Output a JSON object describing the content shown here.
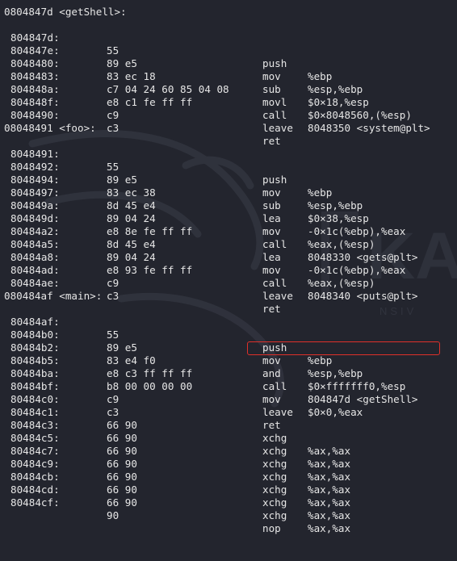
{
  "accent_colors": {
    "background": "#23252e",
    "text": "#e6e6e6",
    "highlight_border": "#e0302a"
  },
  "watermark": {
    "icon": "kali-dragon-logo",
    "text_large": "KA",
    "text_small": "NSIV"
  },
  "functions": [
    {
      "header": "0804847d <getShell>:",
      "rows": [
        {
          "addr": "804847d:",
          "bytes": "55",
          "mnem": "push",
          "ops": "%ebp"
        },
        {
          "addr": "804847e:",
          "bytes": "89 e5",
          "mnem": "mov",
          "ops": "%esp,%ebp"
        },
        {
          "addr": "8048480:",
          "bytes": "83 ec 18",
          "mnem": "sub",
          "ops": "$0×18,%esp"
        },
        {
          "addr": "8048483:",
          "bytes": "c7 04 24 60 85 04 08",
          "mnem": "movl",
          "ops": "$0×8048560,(%esp)"
        },
        {
          "addr": "804848a:",
          "bytes": "e8 c1 fe ff ff",
          "mnem": "call",
          "ops": "8048350 <system@plt>"
        },
        {
          "addr": "804848f:",
          "bytes": "c9",
          "mnem": "leave",
          "ops": ""
        },
        {
          "addr": "8048490:",
          "bytes": "c3",
          "mnem": "ret",
          "ops": ""
        }
      ]
    },
    {
      "header": "08048491 <foo>:",
      "rows": [
        {
          "addr": "8048491:",
          "bytes": "55",
          "mnem": "push",
          "ops": "%ebp"
        },
        {
          "addr": "8048492:",
          "bytes": "89 e5",
          "mnem": "mov",
          "ops": "%esp,%ebp"
        },
        {
          "addr": "8048494:",
          "bytes": "83 ec 38",
          "mnem": "sub",
          "ops": "$0×38,%esp"
        },
        {
          "addr": "8048497:",
          "bytes": "8d 45 e4",
          "mnem": "lea",
          "ops": "-0×1c(%ebp),%eax"
        },
        {
          "addr": "804849a:",
          "bytes": "89 04 24",
          "mnem": "mov",
          "ops": "%eax,(%esp)"
        },
        {
          "addr": "804849d:",
          "bytes": "e8 8e fe ff ff",
          "mnem": "call",
          "ops": "8048330 <gets@plt>"
        },
        {
          "addr": "80484a2:",
          "bytes": "8d 45 e4",
          "mnem": "lea",
          "ops": "-0×1c(%ebp),%eax"
        },
        {
          "addr": "80484a5:",
          "bytes": "89 04 24",
          "mnem": "mov",
          "ops": "%eax,(%esp)"
        },
        {
          "addr": "80484a8:",
          "bytes": "e8 93 fe ff ff",
          "mnem": "call",
          "ops": "8048340 <puts@plt>"
        },
        {
          "addr": "80484ad:",
          "bytes": "c9",
          "mnem": "leave",
          "ops": ""
        },
        {
          "addr": "80484ae:",
          "bytes": "c3",
          "mnem": "ret",
          "ops": ""
        }
      ]
    },
    {
      "header": "080484af <main>:",
      "rows": [
        {
          "addr": "80484af:",
          "bytes": "55",
          "mnem": "push",
          "ops": "%ebp"
        },
        {
          "addr": "80484b0:",
          "bytes": "89 e5",
          "mnem": "mov",
          "ops": "%esp,%ebp"
        },
        {
          "addr": "80484b2:",
          "bytes": "83 e4 f0",
          "mnem": "and",
          "ops": "$0×fffffff0,%esp"
        },
        {
          "addr": "80484b5:",
          "bytes": "e8 c3 ff ff ff",
          "mnem": "call",
          "ops": "804847d <getShell>"
        },
        {
          "addr": "80484ba:",
          "bytes": "b8 00 00 00 00",
          "mnem": "mov",
          "ops": "$0×0,%eax"
        },
        {
          "addr": "80484bf:",
          "bytes": "c9",
          "mnem": "leave",
          "ops": ""
        },
        {
          "addr": "80484c0:",
          "bytes": "c3",
          "mnem": "ret",
          "ops": ""
        },
        {
          "addr": "80484c1:",
          "bytes": "66 90",
          "mnem": "xchg",
          "ops": "%ax,%ax"
        },
        {
          "addr": "80484c3:",
          "bytes": "66 90",
          "mnem": "xchg",
          "ops": "%ax,%ax"
        },
        {
          "addr": "80484c5:",
          "bytes": "66 90",
          "mnem": "xchg",
          "ops": "%ax,%ax"
        },
        {
          "addr": "80484c7:",
          "bytes": "66 90",
          "mnem": "xchg",
          "ops": "%ax,%ax"
        },
        {
          "addr": "80484c9:",
          "bytes": "66 90",
          "mnem": "xchg",
          "ops": "%ax,%ax"
        },
        {
          "addr": "80484cb:",
          "bytes": "66 90",
          "mnem": "xchg",
          "ops": "%ax,%ax"
        },
        {
          "addr": "80484cd:",
          "bytes": "66 90",
          "mnem": "xchg",
          "ops": "%ax,%ax"
        },
        {
          "addr": "80484cf:",
          "bytes": "90",
          "mnem": "nop",
          "ops": ""
        }
      ]
    }
  ]
}
